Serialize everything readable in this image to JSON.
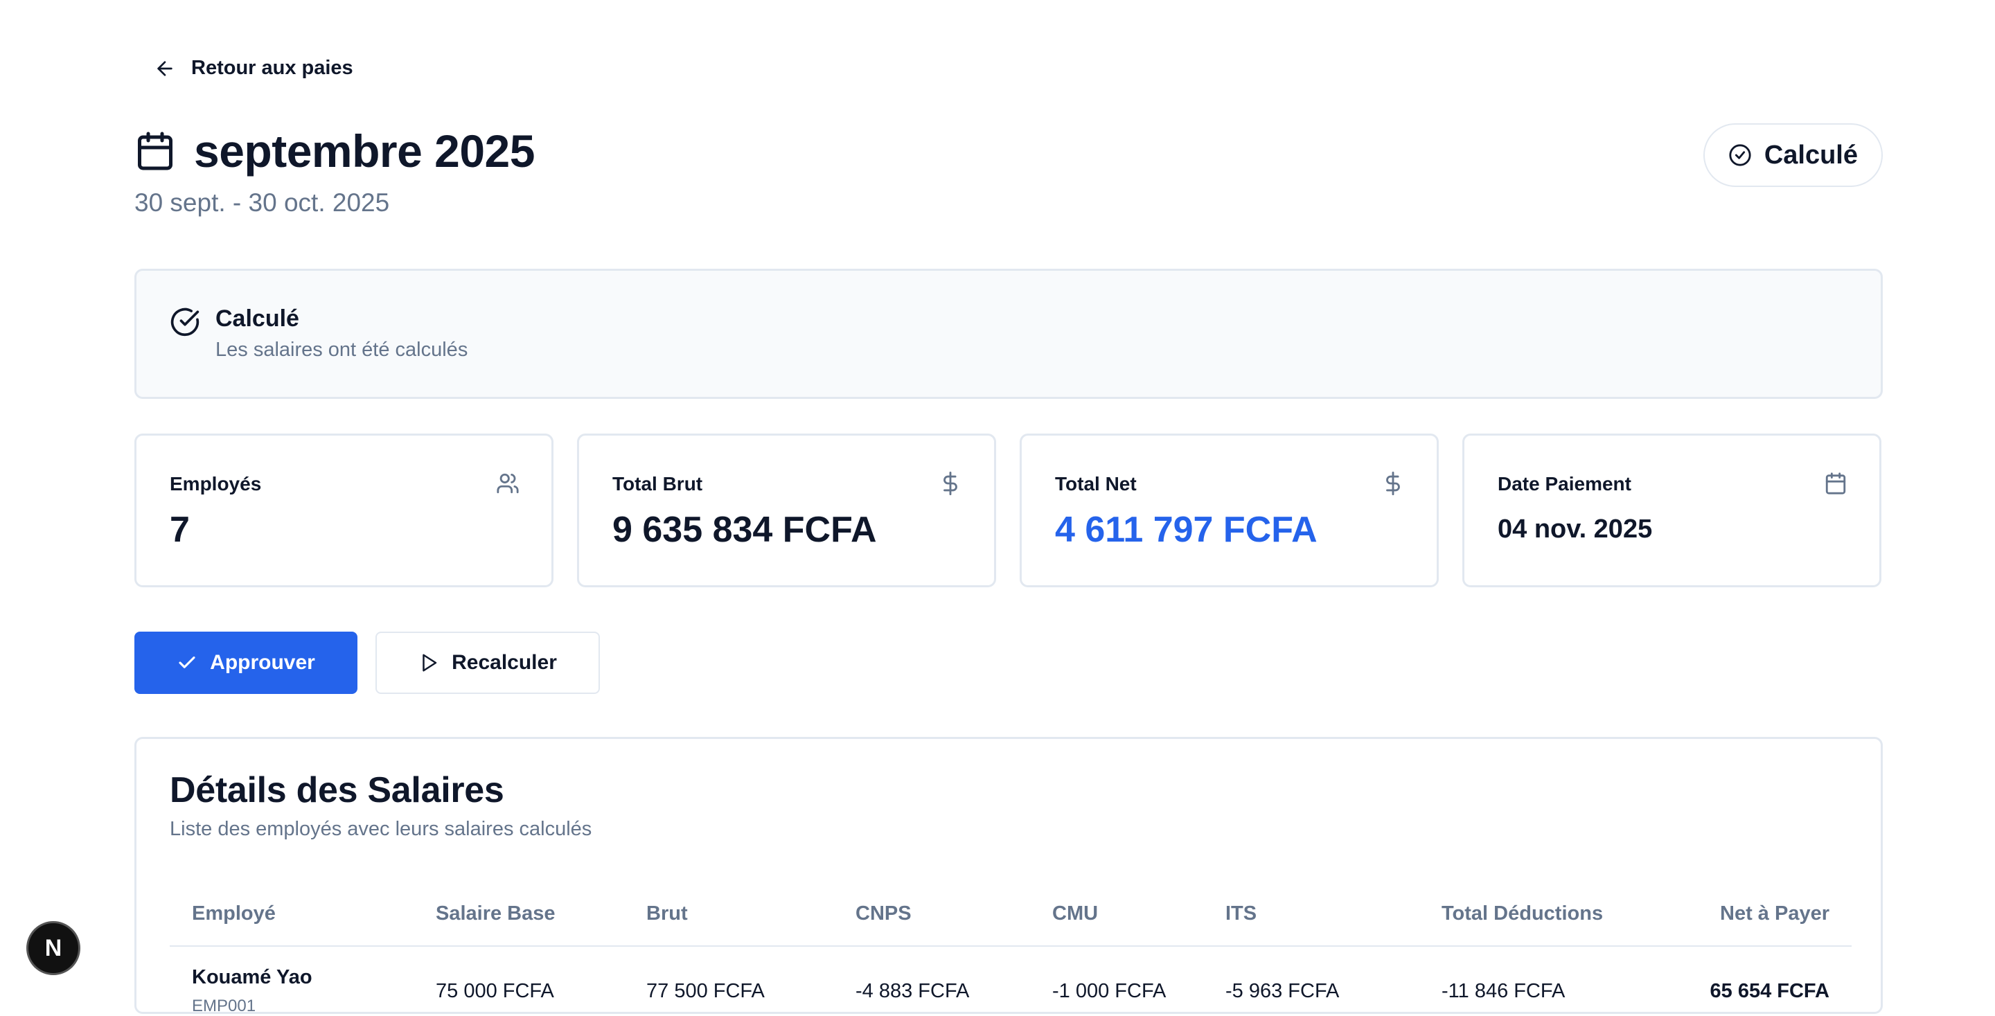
{
  "nav": {
    "back_label": "Retour aux paies"
  },
  "header": {
    "title": "septembre 2025",
    "period": "30 sept. - 30 oct. 2025",
    "status": "Calculé"
  },
  "alert": {
    "title": "Calculé",
    "description": "Les salaires ont été calculés"
  },
  "stats": [
    {
      "label": "Employés",
      "value": "7",
      "icon": "users-icon"
    },
    {
      "label": "Total Brut",
      "value": "9 635 834 FCFA",
      "icon": "dollar-icon"
    },
    {
      "label": "Total Net",
      "value": "4 611 797 FCFA",
      "icon": "dollar-icon",
      "color": "#2563eb"
    },
    {
      "label": "Date Paiement",
      "value": "04 nov. 2025",
      "icon": "calendar-icon"
    }
  ],
  "actions": {
    "approve": "Approuver",
    "recalculate": "Recalculer"
  },
  "details": {
    "title": "Détails des Salaires",
    "description": "Liste des employés avec leurs salaires calculés",
    "columns": [
      "Employé",
      "Salaire Base",
      "Brut",
      "CNPS",
      "CMU",
      "ITS",
      "Total Déductions",
      "Net à Payer"
    ],
    "rows": [
      {
        "name": "Kouamé Yao",
        "code": "EMP001",
        "base": "75 000 FCFA",
        "brut": "77 500 FCFA",
        "cnps": "-4 883 FCFA",
        "cmu": "-1 000 FCFA",
        "its": "-5 963 FCFA",
        "deductions": "-11 846 FCFA",
        "net": "65 654 FCFA"
      }
    ]
  },
  "fab": {
    "label": "N"
  },
  "colors": {
    "primary": "#2563eb",
    "muted": "#64748b",
    "border": "#e2e8f0"
  }
}
